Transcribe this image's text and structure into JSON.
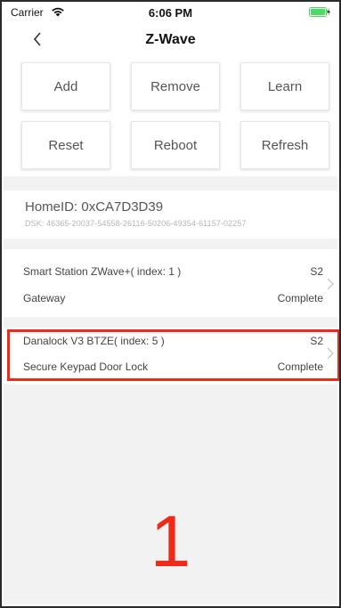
{
  "status_bar": {
    "carrier": "Carrier",
    "time": "6:06 PM",
    "wifi_icon": "wifi-icon",
    "battery_icon": "battery-charging-icon",
    "battery_color": "#4cd964"
  },
  "nav": {
    "back_icon": "chevron-left-icon",
    "title": "Z-Wave"
  },
  "actions": {
    "add": "Add",
    "remove": "Remove",
    "learn": "Learn",
    "reset": "Reset",
    "reboot": "Reboot",
    "refresh": "Refresh"
  },
  "controller": {
    "home_id": "HomeID: 0xCA7D3D39",
    "dsk": "DSK: 46365-20037-54558-26116-50206-49354-61157-02257"
  },
  "nodes": [
    {
      "name": "Smart Station ZWave+( index: 1 )",
      "security": "S2",
      "type": "Gateway",
      "status": "Complete"
    },
    {
      "name": "Danalock V3 BTZE( index: 5 )",
      "security": "S2",
      "type": "Secure Keypad Door Lock",
      "status": "Complete"
    }
  ],
  "annotation": {
    "step": "1",
    "color": "#ee2a18"
  }
}
